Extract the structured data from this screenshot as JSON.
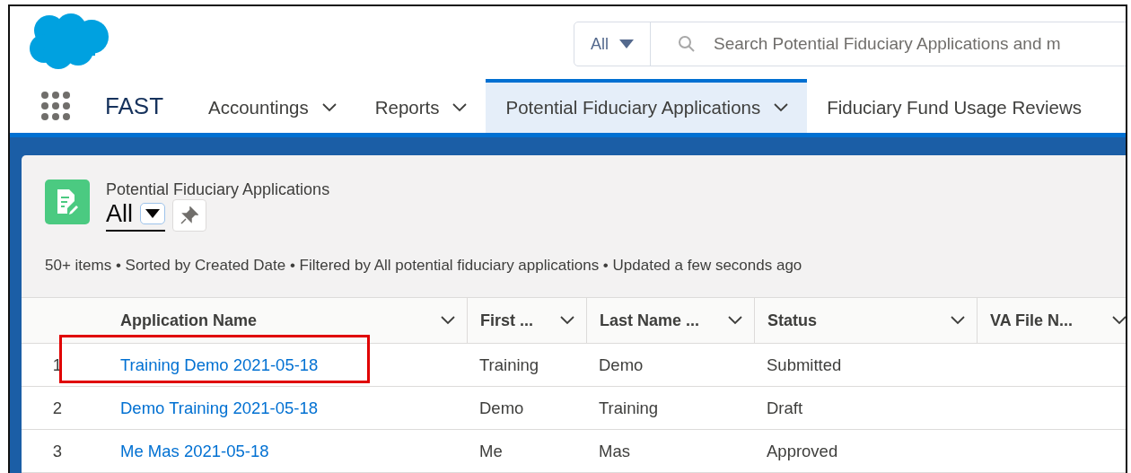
{
  "header": {
    "search": {
      "scope": "All",
      "placeholder": "Search Potential Fiduciary Applications and m"
    }
  },
  "nav": {
    "app_name": "FAST",
    "tabs": [
      {
        "label": "Accountings",
        "selected": false,
        "menu": true
      },
      {
        "label": "Reports",
        "selected": false,
        "menu": true
      },
      {
        "label": "Potential Fiduciary Applications",
        "selected": true,
        "menu": true
      },
      {
        "label": "Fiduciary Fund Usage Reviews",
        "selected": false,
        "menu": false
      }
    ]
  },
  "list_view": {
    "object_name": "Potential Fiduciary Applications",
    "view_name": "All",
    "info": "50+ items • Sorted by Created Date • Filtered by All potential fiduciary applications • Updated a few seconds ago",
    "table": {
      "columns": [
        "Application Name",
        "First ...",
        "Last Name ...",
        "Status",
        "VA File N..."
      ],
      "rows": [
        {
          "number": "1",
          "name": "Training Demo 2021-05-18",
          "first": "Training",
          "last": "Demo",
          "status": "Submitted",
          "highlighted": true
        },
        {
          "number": "2",
          "name": "Demo Training 2021-05-18",
          "first": "Demo",
          "last": "Training",
          "status": "Draft",
          "highlighted": false
        },
        {
          "number": "3",
          "name": "Me Mas 2021-05-18",
          "first": "Me",
          "last": "Mas",
          "status": "Approved",
          "highlighted": false
        }
      ]
    }
  }
}
